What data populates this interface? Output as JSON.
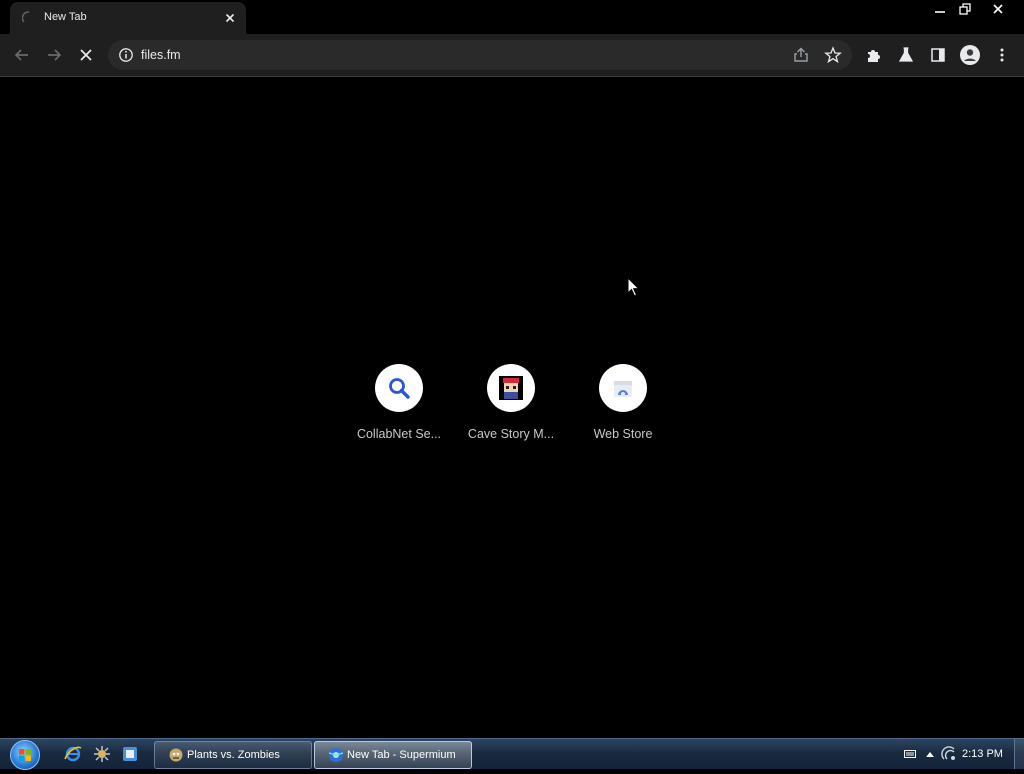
{
  "browser": {
    "tab_title": "New Tab",
    "url": "files.fm",
    "accent": "#1a73e8"
  },
  "toolbar": {
    "icons": [
      "back-arrow-icon",
      "forward-arrow-icon",
      "stop-loading-icon",
      "info-icon",
      "share-icon",
      "star-icon",
      "extensions-icon",
      "labs-flask-icon",
      "side-panel-icon",
      "profile-icon",
      "more-vert-icon"
    ]
  },
  "shortcuts": [
    {
      "label": "CollabNet Se...",
      "icon": "search-magnifier-icon"
    },
    {
      "label": "Cave Story M...",
      "icon": "cave-story-icon"
    },
    {
      "label": "Web Store",
      "icon": "web-store-icon"
    }
  ],
  "taskbar": {
    "tasks": [
      {
        "label": "Plants vs. Zombies",
        "active": false
      },
      {
        "label": "New Tab - Supermium",
        "active": true
      }
    ],
    "clock": "2:13 PM"
  }
}
